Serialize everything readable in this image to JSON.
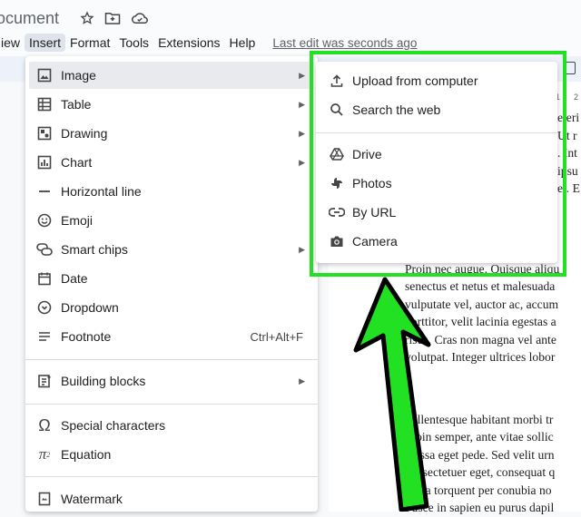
{
  "document": {
    "title": "ocument"
  },
  "menubar": {
    "items": [
      "iew",
      "Insert",
      "Format",
      "Tools",
      "Extensions",
      "Help"
    ],
    "active": "Insert",
    "last_edit": "Last edit was seconds ago"
  },
  "insert_menu": {
    "items": [
      {
        "label": "Image",
        "icon": "image-icon",
        "has_submenu": true,
        "selected": true
      },
      {
        "label": "Table",
        "icon": "table-icon",
        "has_submenu": true
      },
      {
        "label": "Drawing",
        "icon": "drawing-icon",
        "has_submenu": true
      },
      {
        "label": "Chart",
        "icon": "chart-icon",
        "has_submenu": true
      },
      {
        "label": "Horizontal line",
        "icon": "horizontal-line-icon"
      },
      {
        "label": "Emoji",
        "icon": "emoji-icon"
      },
      {
        "label": "Smart chips",
        "icon": "smart-chips-icon",
        "has_submenu": true
      },
      {
        "label": "Date",
        "icon": "calendar-icon"
      },
      {
        "label": "Dropdown",
        "icon": "dropdown-icon"
      },
      {
        "label": "Footnote",
        "icon": "footnote-icon",
        "shortcut": "Ctrl+Alt+F"
      },
      {
        "label": "Building blocks",
        "icon": "building-blocks-icon",
        "has_submenu": true
      },
      {
        "label": "Special characters",
        "icon": "omega-icon"
      },
      {
        "label": "Equation",
        "icon": "pi-icon"
      },
      {
        "label": "Watermark",
        "icon": "watermark-icon"
      }
    ]
  },
  "image_submenu": {
    "items": [
      {
        "label": "Upload from computer",
        "icon": "upload-icon"
      },
      {
        "label": "Search the web",
        "icon": "search-icon"
      },
      {
        "label": "Drive",
        "icon": "drive-icon"
      },
      {
        "label": "Photos",
        "icon": "photos-icon"
      },
      {
        "label": "By URL",
        "icon": "link-icon"
      },
      {
        "label": "Camera",
        "icon": "camera-icon"
      }
    ]
  },
  "ruler": {
    "numbers": [
      "1",
      "2"
    ]
  },
  "document_text": [
    "eleri",
    "Ut r",
    ". Int",
    "ipsu",
    "et. E",
    "Proin nec augue. Quisque aliqu",
    "senectus et netus et malesuada",
    "vulputate vel, auctor ac, accum",
    "porttitor, velit lacinia egestas a",
    "risus. Cras non magna vel ante",
    "volutpat. Integer ultrices lobor",
    "Pellentesque habitant morbi tr",
    "Proin semper, ante vitae sollic",
    "massa eget pede. Sed velit urn",
    "consectetuer eget, consequat q",
    "litora torquent per conubia no",
    "Fusce in sapien eu purus dapil"
  ],
  "colors": {
    "highlight": "#22e022",
    "menu_bg": "#ffffff",
    "selected_bg": "#e9eaed"
  }
}
